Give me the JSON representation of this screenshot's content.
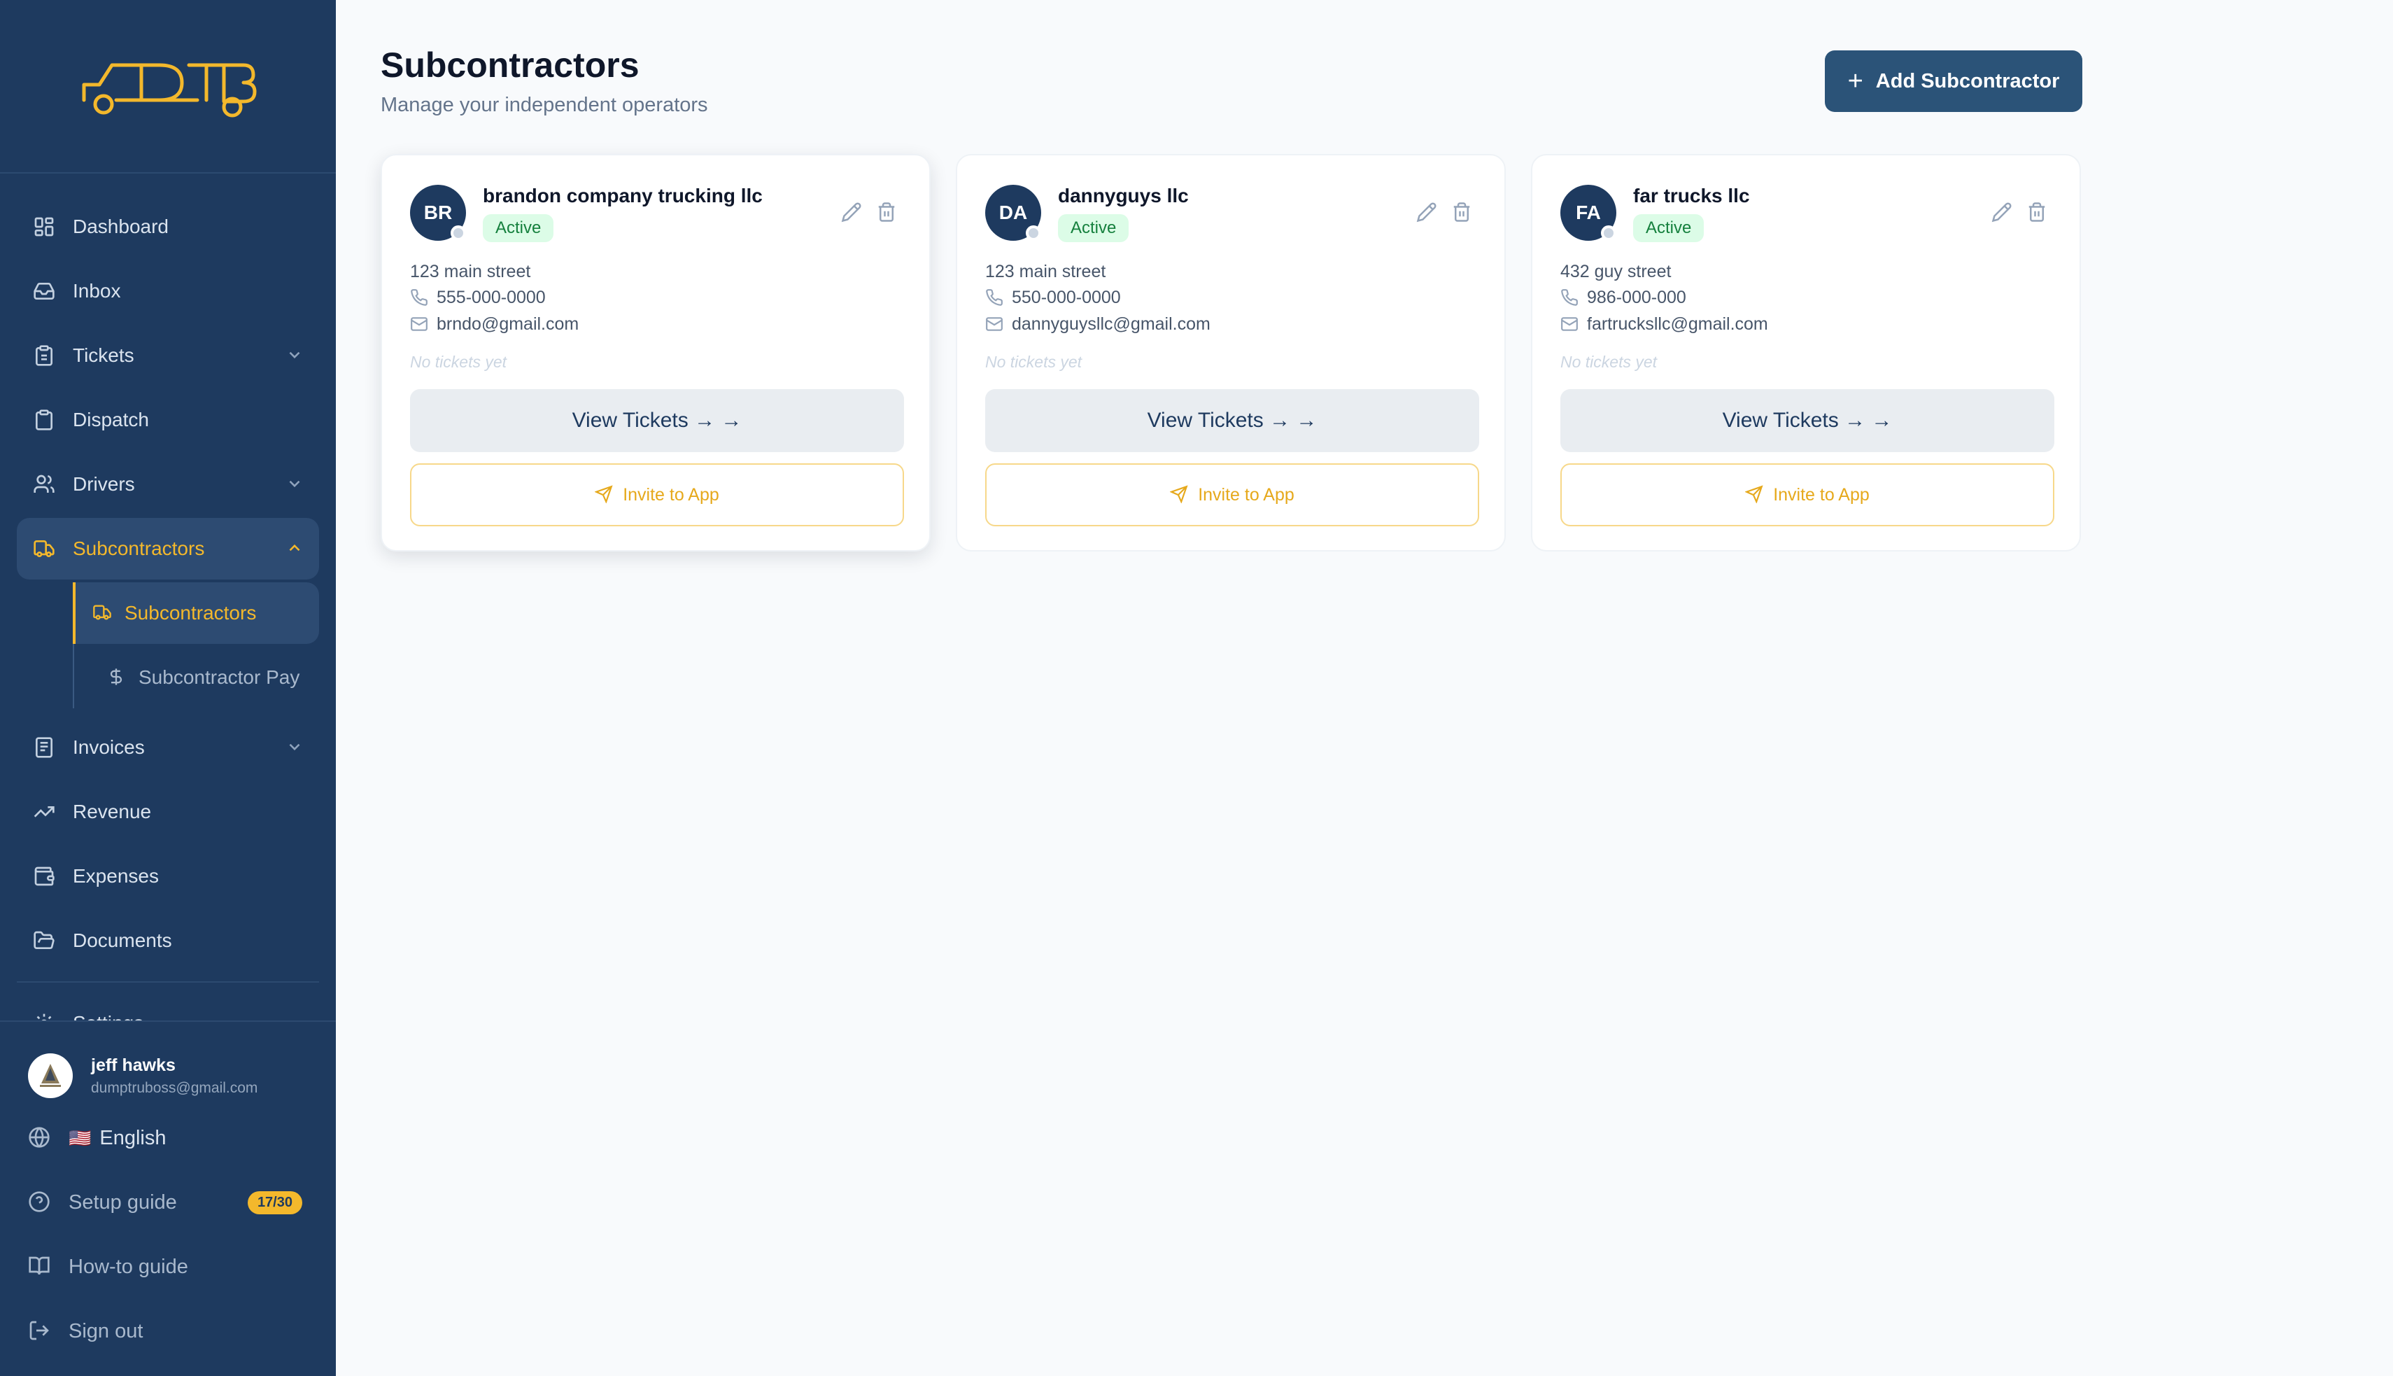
{
  "brand": {
    "accent": "#f3b82c",
    "sidebar_bg": "#1e3a5f",
    "primary_button": "#2b5378",
    "logo_icon": "dump-truck-logo-icon"
  },
  "sidebar": {
    "items": [
      {
        "label": "Dashboard",
        "icon": "grid-icon"
      },
      {
        "label": "Inbox",
        "icon": "inbox-icon"
      },
      {
        "label": "Tickets",
        "icon": "clipboard-icon",
        "expandable": true
      },
      {
        "label": "Dispatch",
        "icon": "clipboard-list-icon"
      },
      {
        "label": "Drivers",
        "icon": "users-icon",
        "expandable": true
      },
      {
        "label": "Subcontractors",
        "icon": "truck-icon",
        "expandable": true,
        "active": true
      },
      {
        "label": "Invoices",
        "icon": "receipt-icon",
        "expandable": true
      },
      {
        "label": "Revenue",
        "icon": "trending-up-icon"
      },
      {
        "label": "Expenses",
        "icon": "wallet-icon"
      },
      {
        "label": "Documents",
        "icon": "folder-open-icon"
      },
      {
        "label": "Settings",
        "icon": "gear-icon"
      }
    ],
    "subitems": [
      {
        "label": "Subcontractors",
        "icon": "truck-icon",
        "active": true
      },
      {
        "label": "Subcontractor Pay",
        "icon": "dollar-icon"
      }
    ],
    "user": {
      "name": "jeff hawks",
      "email": "dumptruboss@gmail.com"
    },
    "language": {
      "flag": "🇺🇸",
      "label": "English"
    },
    "setup_guide": {
      "label": "Setup guide",
      "progress": "17/30"
    },
    "howto_label": "How-to guide",
    "signout_label": "Sign out"
  },
  "main": {
    "title": "Subcontractors",
    "subtitle": "Manage your independent operators",
    "add_button_label": "Add Subcontractor",
    "cards": [
      {
        "initials": "BR",
        "name": "brandon company trucking llc",
        "status": "Active",
        "address": "123 main street",
        "phone": "555-000-0000",
        "email": "brndo@gmail.com",
        "tickets_text": "No tickets yet",
        "view_label": "View Tickets → →",
        "invite_label": "Invite to App"
      },
      {
        "initials": "DA",
        "name": "dannyguys llc",
        "status": "Active",
        "address": "123 main street",
        "phone": "550-000-0000",
        "email": "dannyguysllc@gmail.com",
        "tickets_text": "No tickets yet",
        "view_label": "View Tickets → →",
        "invite_label": "Invite to App"
      },
      {
        "initials": "FA",
        "name": "far trucks llc",
        "status": "Active",
        "address": "432 guy street",
        "phone": "986-000-000",
        "email": "fartrucksllc@gmail.com",
        "tickets_text": "No tickets yet",
        "view_label": "View Tickets → →",
        "invite_label": "Invite to App"
      }
    ]
  }
}
